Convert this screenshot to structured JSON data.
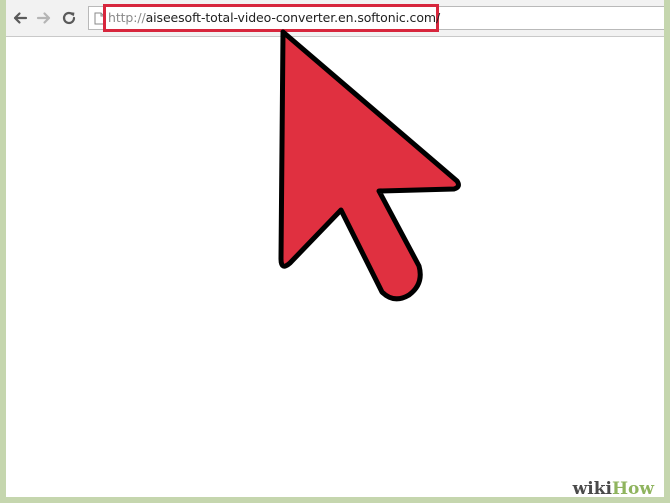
{
  "browser": {
    "nav": {
      "back_icon": "back-arrow-icon",
      "forward_icon": "forward-arrow-icon",
      "reload_icon": "reload-icon"
    },
    "address_bar": {
      "url_protocol": "http://",
      "url_host": "aiseesoft-total-video-converter.en.softonic.com/",
      "highlight_color": "#d7263d"
    }
  },
  "annotation": {
    "cursor_icon": "mouse-pointer-arrow-icon",
    "cursor_fill": "#e03040",
    "cursor_stroke": "#000000"
  },
  "watermark": {
    "part1": "wiki",
    "part2": "How"
  },
  "colors": {
    "border_green": "#c5d6ae",
    "watermark_green": "#8fb45e"
  }
}
